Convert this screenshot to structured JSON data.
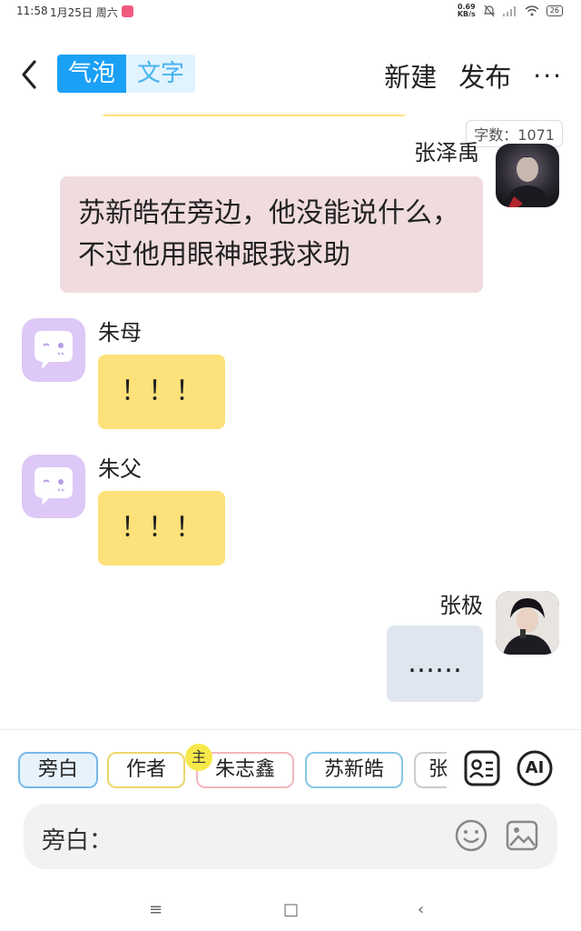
{
  "statusbar": {
    "time": "11:58",
    "date": "1月25日 周六",
    "net_speed": "0.69",
    "net_unit": "KB/s",
    "battery": "26"
  },
  "topbar": {
    "tabs": [
      {
        "label": "气泡"
      },
      {
        "label": "文字"
      }
    ],
    "new_label": "新建",
    "publish_label": "发布",
    "more_label": "···"
  },
  "chat": {
    "word_count": "字数：1071",
    "messages": [
      {
        "sender": "张泽禹",
        "side": "right",
        "text": "苏新皓在旁边，他没能说什么，不过他用眼神跟我求助",
        "bubble_color": "#f0dcdf"
      },
      {
        "sender": "朱母",
        "side": "left",
        "text": "！！！",
        "bubble_color": "#fde17a"
      },
      {
        "sender": "朱父",
        "side": "left",
        "text": "！！！",
        "bubble_color": "#fde17a"
      },
      {
        "sender": "张极",
        "side": "right",
        "text": "……",
        "bubble_color": "#dfe6ef"
      }
    ]
  },
  "roles": {
    "items": [
      {
        "label": "旁白"
      },
      {
        "label": "作者"
      },
      {
        "label": "朱志鑫"
      },
      {
        "label": "苏新皓"
      },
      {
        "label": "张"
      }
    ],
    "main_badge": "主",
    "ai_label": "AI"
  },
  "input": {
    "label": "旁白："
  },
  "navbar": {
    "menu_icon": "≡",
    "home_icon": "□",
    "back_icon": "‹"
  },
  "colors": {
    "accent": "#1aa0f5",
    "accent_light": "#e1f3ff",
    "yellow_bubble": "#fde17a",
    "pink_bubble": "#f0dcdf",
    "grey_bubble": "#dfe6ef",
    "robot_avatar": "#ddc8f7"
  }
}
